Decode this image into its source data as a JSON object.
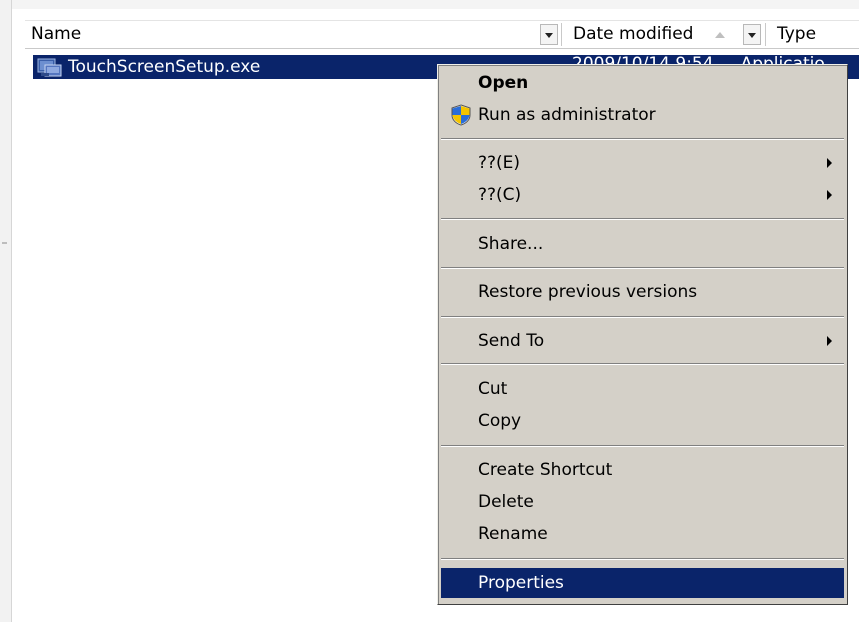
{
  "columns": {
    "name": "Name",
    "date_modified": "Date modified",
    "type": "Type"
  },
  "file": {
    "name": "TouchScreenSetup.exe",
    "date_partial": "2009/10/14 9:54 ...  Applicatio",
    "icon": "installer-icon"
  },
  "context_menu": {
    "open": "Open",
    "run_as_admin": "Run as administrator",
    "item_e": "??(E)",
    "item_c": "??(C)",
    "share": "Share...",
    "restore": "Restore previous versions",
    "send_to": "Send To",
    "cut": "Cut",
    "copy": "Copy",
    "create_shortcut": "Create Shortcut",
    "delete": "Delete",
    "rename": "Rename",
    "properties": "Properties"
  },
  "colors": {
    "selection": "#0a246a",
    "menu_bg": "#d4d0c8"
  }
}
